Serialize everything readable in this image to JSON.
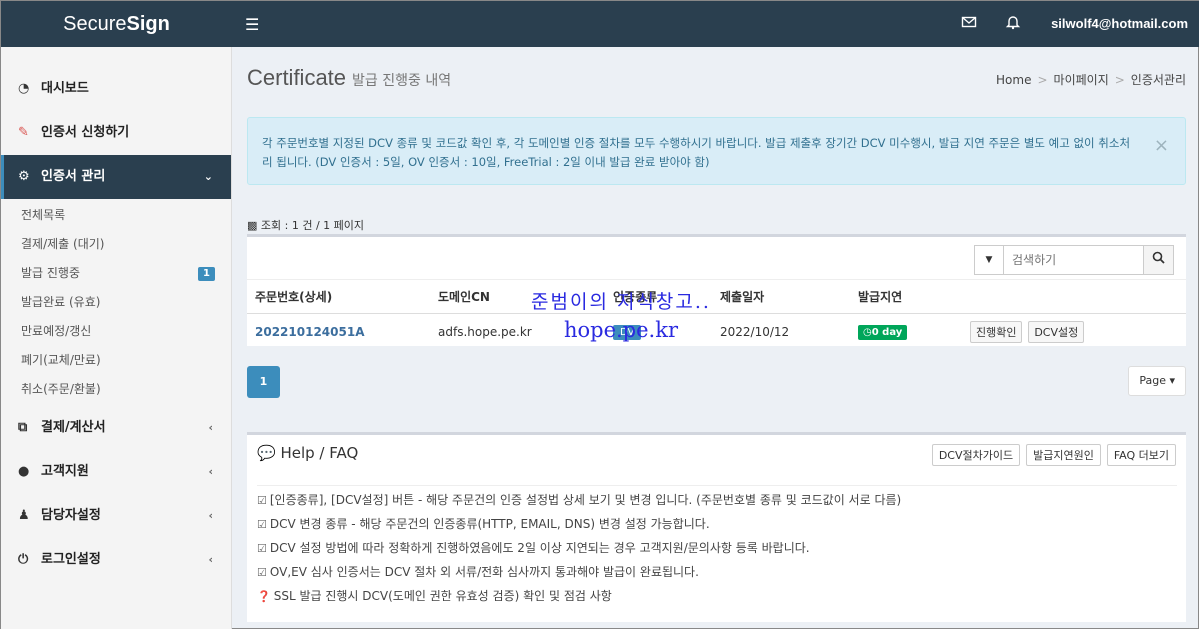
{
  "header": {
    "logo_light": "Secure",
    "logo_bold": "Sign",
    "user_email": "silwolf4@hotmail.com"
  },
  "sidebar": {
    "items": [
      {
        "label": "대시보드",
        "icon": "dashboard-icon"
      },
      {
        "label": "인증서 신청하기",
        "icon": "edit-icon"
      },
      {
        "label": "인증서 관리",
        "icon": "gears-icon"
      },
      {
        "label": "결제/계산서",
        "icon": "copy-icon"
      },
      {
        "label": "고객지원",
        "icon": "comments-icon"
      },
      {
        "label": "담당자설정",
        "icon": "users-icon"
      },
      {
        "label": "로그인설정",
        "icon": "power-icon"
      }
    ],
    "sub_items": [
      {
        "label": "전체목록"
      },
      {
        "label": "결제/제출 (대기)"
      },
      {
        "label": "발급 진행중",
        "badge": "1"
      },
      {
        "label": "발급완료 (유효)"
      },
      {
        "label": "만료예정/갱신"
      },
      {
        "label": "폐기(교체/만료)"
      },
      {
        "label": "취소(주문/환불)"
      }
    ]
  },
  "page": {
    "title": "Certificate",
    "subtitle": "발급 진행중 내역",
    "breadcrumb": [
      "Home",
      "마이페이지",
      "인증서관리"
    ]
  },
  "alert": {
    "text": "각 주문번호별 지정된 DCV 종류 및 코드값 확인 후, 각 도메인별 인증 절차를 모두 수행하시기 바랍니다. 발급 제출후 장기간 DCV 미수행시, 발급 지연 주문은 별도 예고 없이 취소처리 됩니다. (DV 인증서 : 5일, OV 인증서 : 10일, FreeTrial : 2일 이내 발급 완료 받아야 함)"
  },
  "count_text": "조회 : 1 건 / 1 페이지",
  "search": {
    "placeholder": "검색하기"
  },
  "table": {
    "headers": [
      "주문번호(상세)",
      "도메인CN",
      "인증종류",
      "제출일자",
      "발급지연"
    ],
    "rows": [
      {
        "order_no": "202210124051A",
        "domain": "adfs.hope.pe.kr",
        "type": "DV",
        "date": "2022/10/12",
        "delay": "0 day",
        "btn_progress": "진행확인",
        "btn_dcv": "DCV설정"
      }
    ]
  },
  "watermark": {
    "line1": "준범이의 지식창고..",
    "line2": "hope.pe.kr"
  },
  "pagination": {
    "current": "1",
    "page_label": "Page"
  },
  "faq": {
    "title": "Help / FAQ",
    "buttons": [
      "DCV절차가이드",
      "발급지연원인",
      "FAQ 더보기"
    ],
    "lines": [
      "[인증종류], [DCV설정] 버튼 - 해당 주문건의 인증 설정법 상세 보기 및 변경 입니다. (주문번호별 종류 및 코드값이 서로 다름)",
      "DCV 변경 종류 - 해당 주문건의 인증종류(HTTP, EMAIL, DNS) 변경 설정 가능합니다.",
      "DCV 설정 방법에 따라 정확하게 진행하였음에도 2일 이상 지연되는 경우 고객지원/문의사항 등록 바랍니다.",
      "OV,EV 심사 인증서는 DCV 절차 외 서류/전화 심사까지 통과해야 발급이 완료됩니다.",
      "SSL 발급 진행시 DCV(도메인 권한 유효성 검증) 확인 및 점검 사항"
    ]
  },
  "colors": {
    "header_bg": "#2a3f4f",
    "primary": "#3c8dbc",
    "success": "#00a65a",
    "alert_bg": "#d9edf7"
  }
}
